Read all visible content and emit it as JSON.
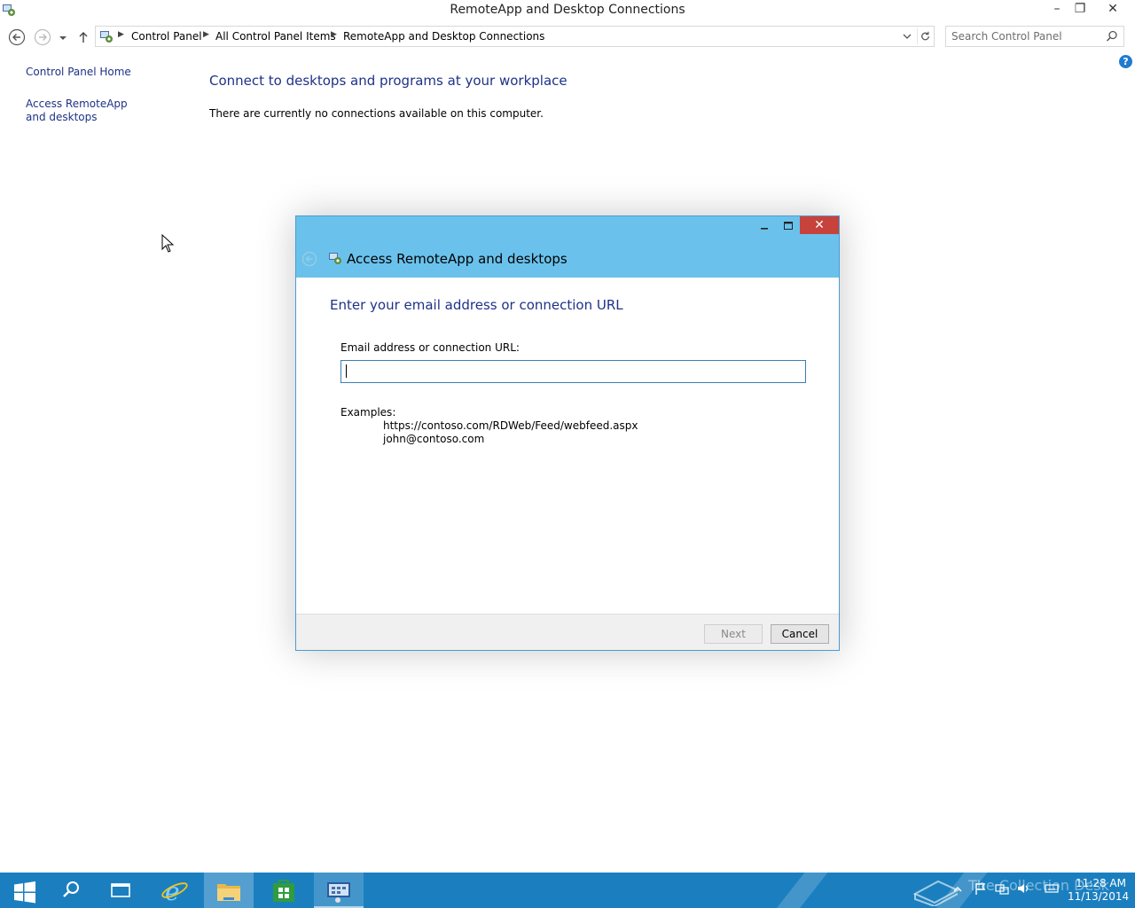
{
  "window": {
    "title": "RemoteApp and Desktop Connections",
    "minimize_glyph": "–",
    "maximize_glyph": "❐",
    "close_glyph": "✕"
  },
  "address_bar": {
    "crumbs": [
      "Control Panel",
      "All Control Panel Items",
      "RemoteApp and Desktop Connections"
    ]
  },
  "search": {
    "placeholder": "Search Control Panel"
  },
  "left_nav": {
    "home": "Control Panel Home",
    "access": "Access RemoteApp and desktops"
  },
  "help_glyph": "?",
  "main": {
    "title": "Connect to desktops and programs at your workplace",
    "message": "There are currently no connections available on this computer."
  },
  "dialog": {
    "title": "Access RemoteApp and desktops",
    "heading": "Enter your email address or connection URL",
    "field_label": "Email address or connection URL:",
    "field_value": "",
    "examples_label": "Examples:",
    "examples": [
      "https://contoso.com/RDWeb/Feed/webfeed.aspx",
      "john@contoso.com"
    ],
    "next_label": "Next",
    "cancel_label": "Cancel",
    "close_glyph": "✕"
  },
  "taskbar": {
    "items": [
      "start-icon",
      "search-icon",
      "task-view-icon",
      "internet-explorer-icon",
      "file-explorer-icon",
      "store-icon",
      "control-panel-icon"
    ],
    "watermark": "The Collection Desk",
    "time": "11:28 AM",
    "date": "11/13/2014"
  },
  "colors": {
    "link": "#1e3287",
    "dialog_header": "#6ac2ec",
    "close_red": "#c7423a",
    "taskbar": "#1b7fbf"
  }
}
